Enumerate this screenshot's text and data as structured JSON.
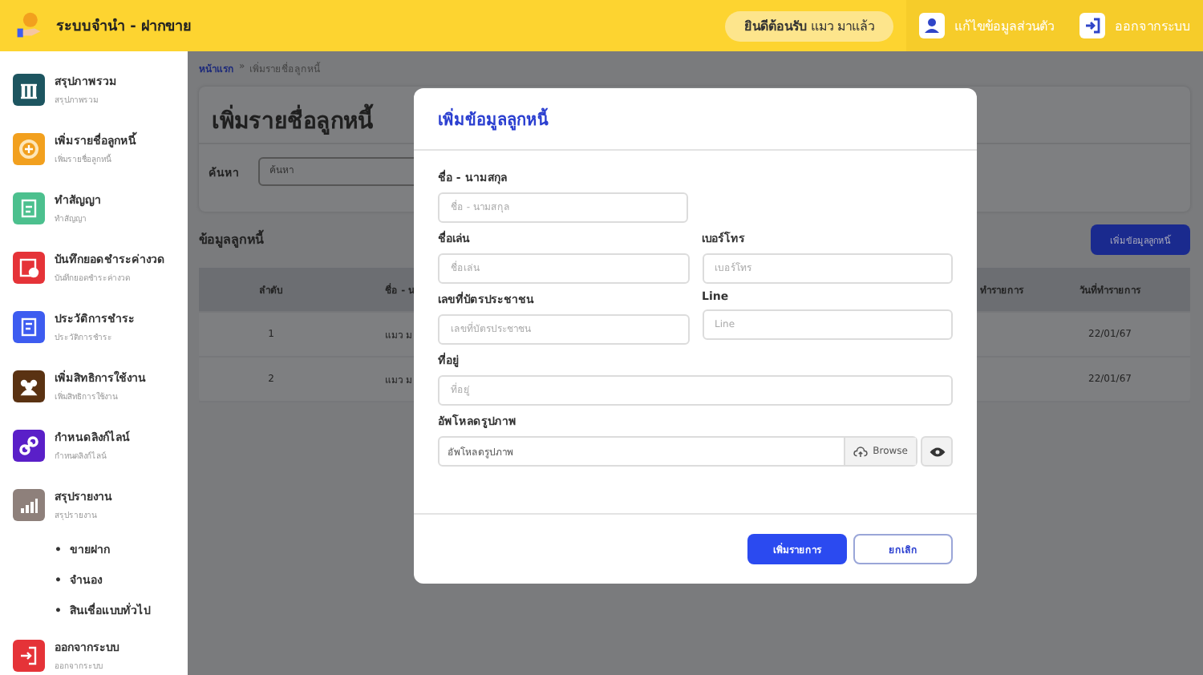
{
  "header": {
    "title": "ระบบจำนำ - ฝากขาย",
    "welcome": "**ยินดีต้อนรับ** แมว มาแล้ว",
    "actions": [
      {
        "kind": "profile",
        "label": "แก้ไขข้อมูลส่วนตัว"
      },
      {
        "kind": "logout",
        "label": "ออกจากระบบ"
      }
    ]
  },
  "sidebar": {
    "items": [
      {
        "kind": "summary",
        "title": "สรุปภาพรวม",
        "subtitle": "สรุปภาพรวม",
        "color": "#1d5560"
      },
      {
        "kind": "add",
        "title": "เพิ่มรายชื่อลูกหนี้",
        "subtitle": "เพิ่มรายชื่อลูกหนี้",
        "color": "#f2a01e"
      },
      {
        "kind": "contract",
        "title": "ทำสัญญา",
        "subtitle": "ทำสัญญา",
        "color": "#4cc08e"
      },
      {
        "kind": "payment",
        "title": "บันทึกยอดชำระค่างวด",
        "subtitle": "บันทึกยอดชำระค่างวด",
        "color": "#e53338"
      },
      {
        "kind": "history",
        "title": "ประวัติการชำระ",
        "subtitle": "ประวัติการชำระ",
        "color": "#3d5cf0"
      },
      {
        "kind": "users",
        "title": "เพิ่มสิทธิการใช้งาน",
        "subtitle": "เพิ่มสิทธิการใช้งาน",
        "color": "#5a3212"
      },
      {
        "kind": "link",
        "title": "กำหนดลิงก์ไลน์",
        "subtitle": "กำหนดลิงก์ไลน์",
        "color": "#5a1fc8"
      },
      {
        "kind": "report",
        "title": "สรุปรายงาน",
        "subtitle": "สรุปรายงาน",
        "color": "#8e807b",
        "children": [
          {
            "bullet": "•",
            "label": "ขายฝาก"
          },
          {
            "bullet": "•",
            "label": "จำนอง"
          },
          {
            "bullet": "•",
            "label": "สินเชื่อแบบทั่วไป"
          }
        ]
      },
      {
        "kind": "logout",
        "title": "ออกจากระบบ",
        "subtitle": "ออกจากระบบ",
        "color": "#e53338"
      }
    ]
  },
  "page": {
    "breadcrumb_separator": "»",
    "breadcrumb": [
      {
        "label": "หน้าแรก",
        "selected": false
      },
      {
        "label": "เพิ่มรายชื่อลูกหนี้",
        "selected": true
      }
    ],
    "title": "เพิ่มรายชื่อลูกหนี้",
    "search": {
      "label": "ค้นหา",
      "placeholder": "ค้นหา"
    },
    "section": "ข้อมูลลูกหนี้",
    "add_button": "เพิ่มข้อมูลลูกหนี้",
    "table": {
      "columns": [
        "ลำดับ",
        "ชื่อ - น",
        "ทำรายการ",
        "วันที่ทำรายการ"
      ],
      "rows": [
        {
          "no": "1",
          "name": "แมว ม",
          "date": "22/01/67"
        },
        {
          "no": "2",
          "name": "แมว ม",
          "date": "22/01/67"
        }
      ]
    }
  },
  "modal": {
    "title": "เพิ่มข้อมูลลูกหนี้",
    "rows": [
      [
        {
          "kind": "text",
          "label": "ชื่อ - นามสกุล",
          "placeholder": "ชื่อ - นามสกุล"
        }
      ],
      [
        {
          "kind": "text",
          "label": "ชื่อเล่น",
          "placeholder": "ชื่อเล่น"
        },
        {
          "kind": "text",
          "label": "เบอร์โทร",
          "placeholder": "เบอร์โทร"
        }
      ],
      [
        {
          "kind": "text",
          "label": "เลขที่บัตรประชาชน",
          "placeholder": "เลขที่บัตรประชาชน"
        },
        {
          "kind": "text",
          "label": "Line",
          "placeholder": "Line"
        }
      ],
      [
        {
          "kind": "wide",
          "label": "ที่อยู่",
          "placeholder": "ที่อยู่"
        }
      ],
      [
        {
          "kind": "file",
          "label": "อัพโหลดรูปภาพ",
          "value": "อัพโหลดรูปภาพ",
          "browse": "Browse"
        }
      ]
    ],
    "buttons": [
      {
        "kind": "primary",
        "label": "เพิ่มรายการ"
      },
      {
        "kind": "secondary",
        "label": "ยกเลิก"
      }
    ]
  }
}
